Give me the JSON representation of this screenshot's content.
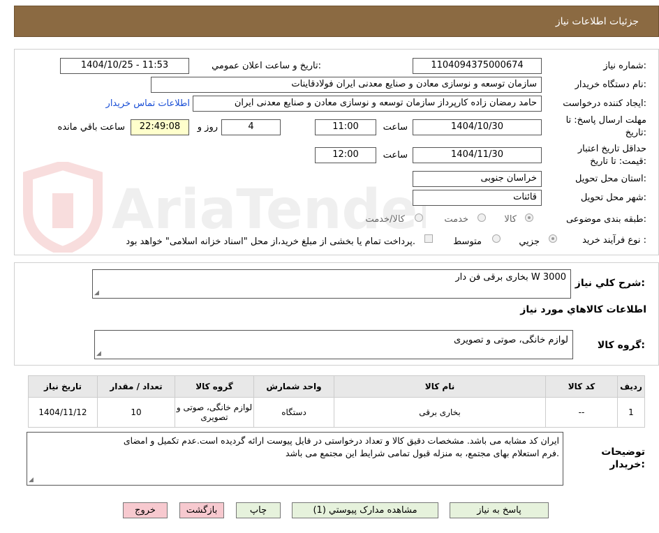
{
  "header": {
    "title": "جزئیات اطلاعات نیاز"
  },
  "watermark": {
    "text": "AriaTender.neT"
  },
  "form": {
    "need_number_label": "شماره نیاز:",
    "need_number": "1104094375000674",
    "announce_label": "تاریخ و ساعت اعلان عمومي:",
    "announce_value": "1404/10/25 - 11:53",
    "buyer_org_label": "نام دستگاه خریدار:",
    "buyer_org": "سازمان توسعه و نوسازی معادن و صنایع معدنی ایران فولادقاینات",
    "requester_label": "ایجاد کننده درخواست:",
    "requester": "حامد  رمضان زاده  کارپرداز  سازمان توسعه و نوسازی معادن و صنایع معدنی ایران",
    "contact_link": "اطلاعات تماس خریدار",
    "reply_deadline_label_1": "مهلت ارسال پاسخ: تا",
    "reply_deadline_label_2": "تاریخ:",
    "reply_date": "1404/10/30",
    "time_label": "ساعت",
    "reply_time": "11:00",
    "days": "4",
    "days_label": "روز و",
    "remaining_time": "22:49:08",
    "remaining_label": "ساعت باقي مانده",
    "price_valid_label_1": "حداقل تاریخ اعتبار",
    "price_valid_label_2": "قیمت: تا تاریخ:",
    "price_valid_date": "1404/11/30",
    "price_valid_time": "12:00",
    "province_label": "استان محل تحویل:",
    "province": "خراسان جنوبی",
    "city_label": "شهر محل تحویل:",
    "city": "قائنات",
    "category_label": "طبقه بندی موضوعی:",
    "category_options": [
      "کالا",
      "خدمت",
      "کالا/خدمت"
    ],
    "process_label": "نوع فرآیند خرید :",
    "process_options": [
      "جزیي",
      "متوسط"
    ],
    "payment_note": "پرداخت تمام یا بخشی از مبلغ خرید،از محل \"اسناد خزانه اسلامی\" خواهد بود."
  },
  "summary": {
    "label": "شرح کلي نیاز:",
    "value": "بخاری  برقی فن دار W 3000"
  },
  "goods_section": {
    "title": "اطلاعات کالاهاي مورد نیاز",
    "group_label": "گروه کالا:",
    "group_value": "لوازم خانگی، صوتی و تصویری"
  },
  "table": {
    "headers": [
      "ردیف",
      "کد کالا",
      "نام کالا",
      "واحد شمارش",
      "گروه کالا",
      "تعداد / مقدار",
      "تاریخ نیاز"
    ],
    "rows": [
      {
        "row": "1",
        "code": "--",
        "name": "بخاری برقی",
        "unit": "دستگاه",
        "group": "لوازم خانگی، صوتی و تصویری",
        "qty": "10",
        "date": "1404/11/12"
      }
    ]
  },
  "buyer_notes": {
    "label_1": "توضیحات",
    "label_2": "خریدار:",
    "line_1": "ایران کد مشابه می باشد. مشخصات دقیق کالا و تعداد درخواستی در فایل پیوست ارائه گردیده است.عدم تکمیل و امضای",
    "line_2": "فرم استعلام بهای مجتمع، به منزله قبول تمامی شرایط این مجتمع می باشد."
  },
  "buttons": {
    "reply": "پاسخ به نیاز",
    "attachments": "مشاهده مدارک پیوستي (1)",
    "print": "چاپ",
    "back": "بازگشت",
    "exit": "خروج"
  },
  "colors": {
    "title_bar": "#8b6a42",
    "highlight": "#ffffcc",
    "link": "#1a4fd6",
    "button_green": "#e6f2dc",
    "button_pink": "#f7c9cf"
  }
}
